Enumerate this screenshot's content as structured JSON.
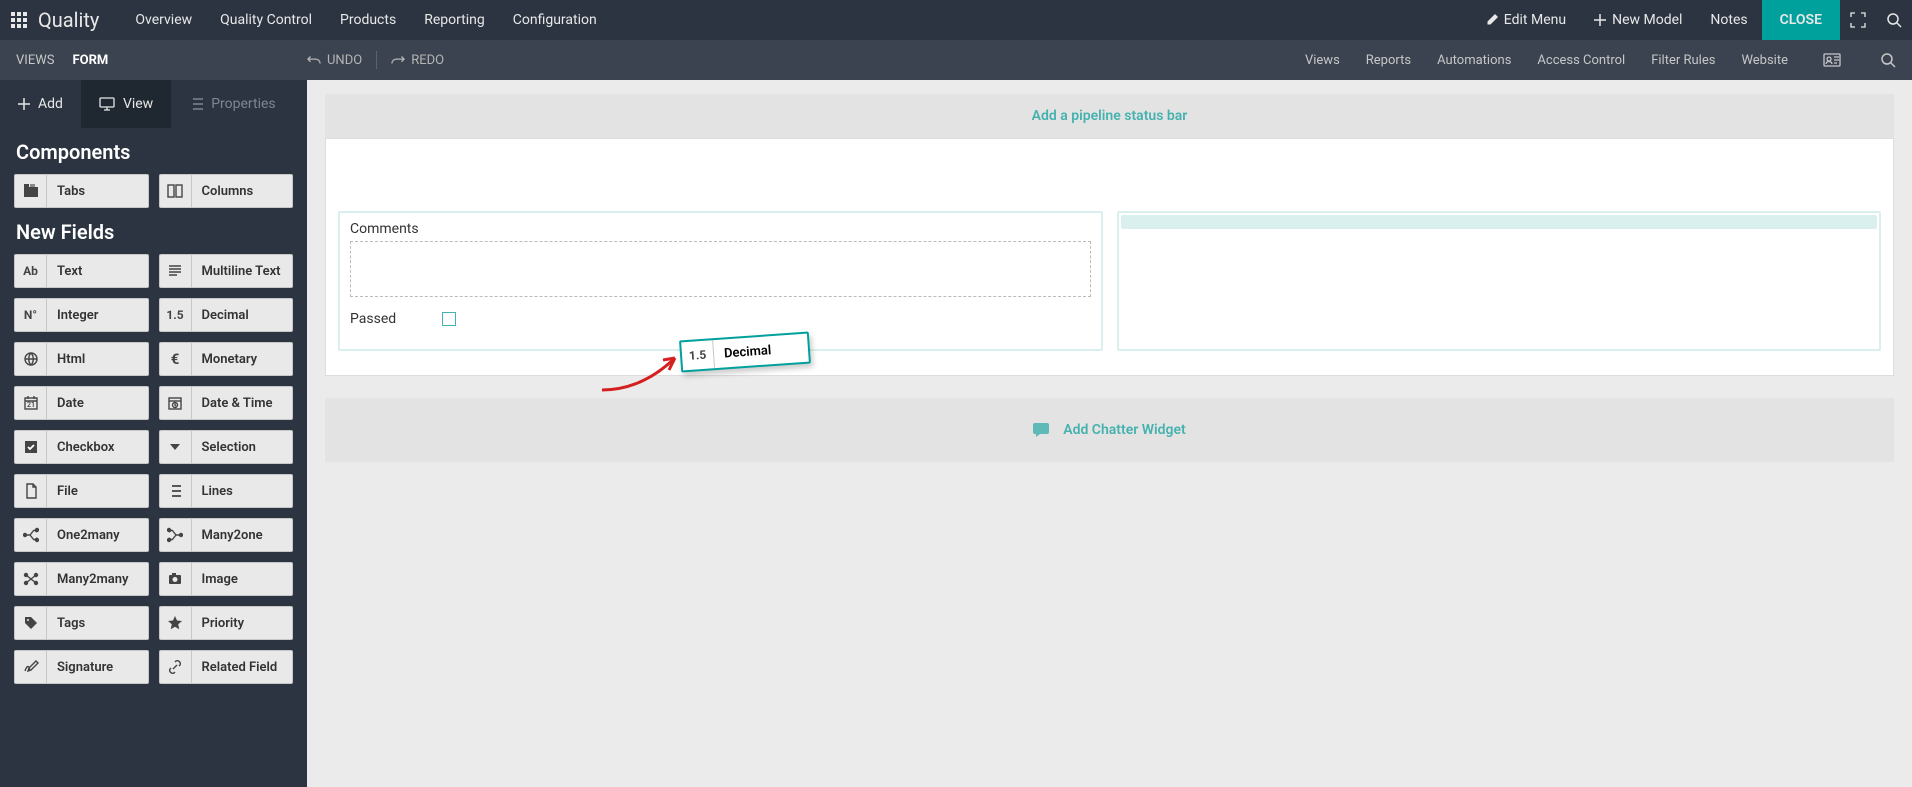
{
  "top": {
    "app_title": "Quality",
    "nav": [
      "Overview",
      "Quality Control",
      "Products",
      "Reporting",
      "Configuration"
    ],
    "edit_menu": "Edit Menu",
    "new_model": "New Model",
    "notes": "Notes",
    "close": "CLOSE"
  },
  "subbar": {
    "views": "VIEWS",
    "form": "FORM",
    "undo": "UNDO",
    "redo": "REDO",
    "links": [
      "Views",
      "Reports",
      "Automations",
      "Access Control",
      "Filter Rules",
      "Website"
    ]
  },
  "side_tabs": {
    "add": "Add",
    "view": "View",
    "props": "Properties"
  },
  "sections": {
    "components": "Components",
    "new_fields": "New Fields"
  },
  "components": [
    {
      "icon": "tabs",
      "label": "Tabs"
    },
    {
      "icon": "columns",
      "label": "Columns"
    }
  ],
  "fields": [
    {
      "icon": "Ab",
      "label": "Text"
    },
    {
      "icon": "lines",
      "label": "Multiline Text"
    },
    {
      "icon": "N°",
      "label": "Integer"
    },
    {
      "icon": "1.5",
      "label": "Decimal"
    },
    {
      "icon": "globe",
      "label": "Html"
    },
    {
      "icon": "euro",
      "label": "Monetary"
    },
    {
      "icon": "cal",
      "label": "Date"
    },
    {
      "icon": "clock",
      "label": "Date & Time"
    },
    {
      "icon": "check",
      "label": "Checkbox"
    },
    {
      "icon": "caret",
      "label": "Selection"
    },
    {
      "icon": "file",
      "label": "File"
    },
    {
      "icon": "list",
      "label": "Lines"
    },
    {
      "icon": "o2m",
      "label": "One2many"
    },
    {
      "icon": "m2o",
      "label": "Many2one"
    },
    {
      "icon": "m2m",
      "label": "Many2many"
    },
    {
      "icon": "camera",
      "label": "Image"
    },
    {
      "icon": "tag",
      "label": "Tags"
    },
    {
      "icon": "star",
      "label": "Priority"
    },
    {
      "icon": "sign",
      "label": "Signature"
    },
    {
      "icon": "link",
      "label": "Related Field"
    }
  ],
  "canvas": {
    "pipeline": "Add a pipeline status bar",
    "comments": "Comments",
    "passed": "Passed",
    "chatter": "Add Chatter Widget"
  },
  "drag": {
    "icon": "1.5",
    "label": "Decimal"
  }
}
